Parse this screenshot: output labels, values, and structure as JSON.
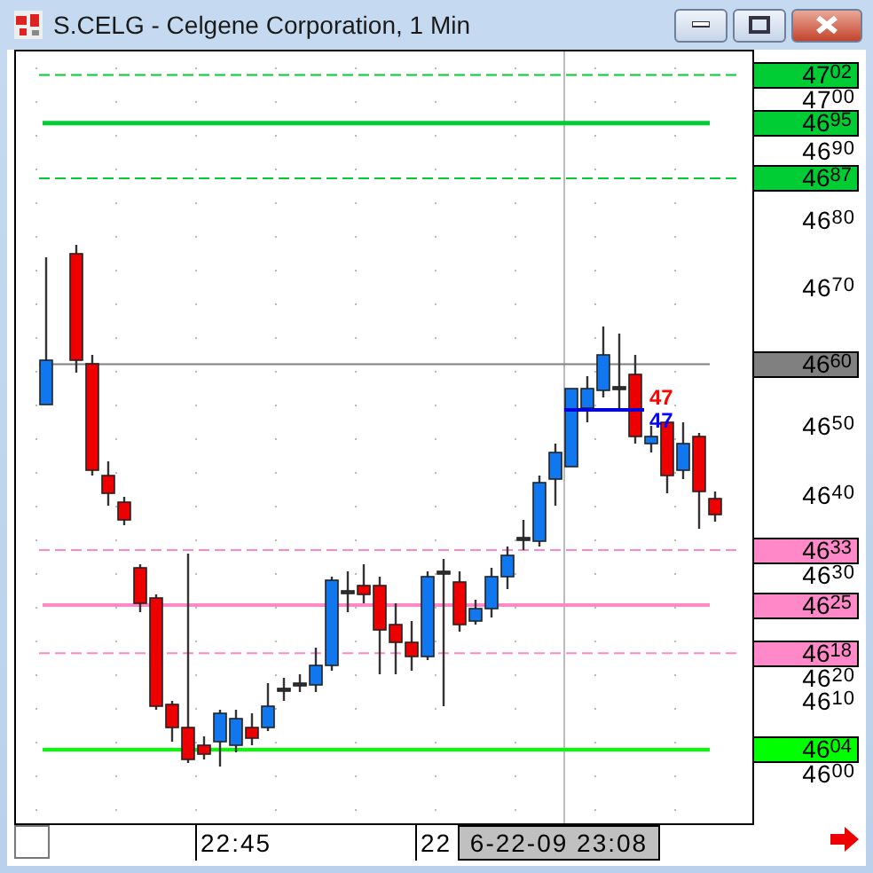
{
  "window": {
    "title": "S.CELG - Celgene Corporation, 1 Min"
  },
  "price_axis": {
    "labels": [
      "47$^{00}$",
      "46$^{90}$",
      "46$^{80}$",
      "46$^{70}$",
      "46$^{50}$",
      "46$^{40}$",
      "46$^{30}$",
      "46$^{20}$",
      "46$^{10}$",
      "46$^{00}$"
    ]
  },
  "price_tags": [
    {
      "value": "47$^{02}$",
      "color": "#00cc33",
      "kind": "dashed"
    },
    {
      "value": "46$^{95}$",
      "color": "#00cc33",
      "kind": "solid"
    },
    {
      "value": "46$^{87}$",
      "color": "#00cc33",
      "kind": "dashed"
    },
    {
      "value": "46$^{60}$",
      "color": "#808080",
      "kind": "solid"
    },
    {
      "value": "46$^{33}$",
      "color": "#ff88c8",
      "kind": "dashed"
    },
    {
      "value": "46$^{25}$",
      "color": "#ff88c8",
      "kind": "solid"
    },
    {
      "value": "46$^{18}$",
      "color": "#ff88c8",
      "kind": "dashed"
    },
    {
      "value": "46$^{04}$",
      "color": "#00ff00",
      "kind": "solid"
    }
  ],
  "time_axis": {
    "labels": [
      "22:45",
      "22"
    ]
  },
  "crosshair": {
    "time": "6-22-09 23:08",
    "value_labels": [
      {
        "text": "47",
        "color": "#ff0000"
      },
      {
        "text": "47",
        "color": "#0000ff"
      }
    ]
  }
}
